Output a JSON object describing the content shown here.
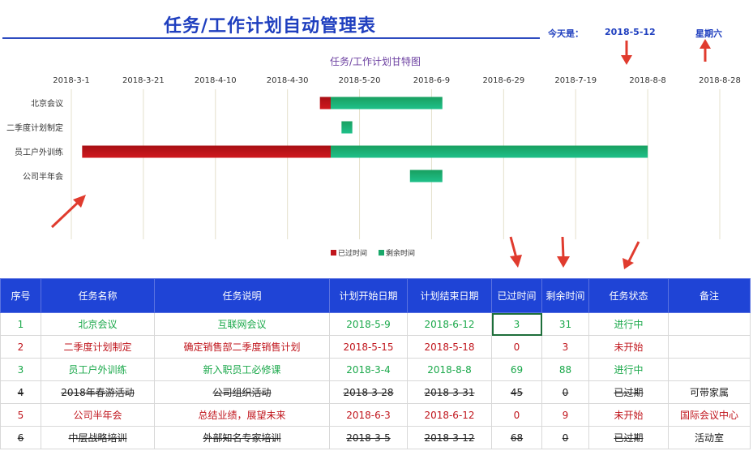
{
  "title": "任务/工作计划自动管理表",
  "today_label": "今天是：",
  "today_date": "2018-5-12",
  "weekday": "星期六",
  "colors": {
    "header_bg": "#1f44d6",
    "passed": "#c0151c",
    "remaining": "#19a86a",
    "title": "#1f3fbf"
  },
  "chart_data": {
    "type": "bar",
    "orientation": "horizontal-stacked-gantt",
    "title": "任务/工作计划甘特图",
    "x_ticks": [
      "2018-3-1",
      "2018-3-21",
      "2018-4-10",
      "2018-4-30",
      "2018-5-20",
      "2018-6-9",
      "2018-6-29",
      "2018-7-19",
      "2018-8-8",
      "2018-8-28"
    ],
    "xlim": [
      "2018-3-1",
      "2018-8-28"
    ],
    "grid": true,
    "legend_position": "bottom",
    "categories": [
      "北京会议",
      "二季度计划制定",
      "员工户外训练",
      "公司半年会"
    ],
    "series": [
      {
        "name": "已过时间",
        "color": "#c0151c",
        "segments": [
          {
            "start": "2018-5-9",
            "days": 3
          },
          {
            "start": "2018-5-15",
            "days": 0
          },
          {
            "start": "2018-3-4",
            "days": 69
          },
          {
            "start": "2018-6-3",
            "days": 0
          }
        ]
      },
      {
        "name": "剩余时间",
        "color": "#19a86a",
        "segments": [
          {
            "start": "2018-5-12",
            "days": 31
          },
          {
            "start": "2018-5-15",
            "days": 3
          },
          {
            "start": "2018-5-12",
            "days": 88
          },
          {
            "start": "2018-6-3",
            "days": 9
          }
        ]
      }
    ]
  },
  "table": {
    "headers": [
      "序号",
      "任务名称",
      "任务说明",
      "计划开始日期",
      "计划结束日期",
      "已过时间",
      "剩余时间",
      "任务状态",
      "备注"
    ],
    "rows": [
      {
        "cls": "green",
        "cells": [
          "1",
          "北京会议",
          "互联网会议",
          "2018-5-9",
          "2018-6-12",
          "3",
          "31",
          "进行中",
          ""
        ]
      },
      {
        "cls": "red",
        "cells": [
          "2",
          "二季度计划制定",
          "确定销售部二季度销售计划",
          "2018-5-15",
          "2018-5-18",
          "0",
          "3",
          "未开始",
          ""
        ]
      },
      {
        "cls": "green",
        "cells": [
          "3",
          "员工户外训练",
          "新入职员工必修课",
          "2018-3-4",
          "2018-8-8",
          "69",
          "88",
          "进行中",
          ""
        ]
      },
      {
        "cls": "black",
        "cells": [
          "4",
          "2018年春游活动",
          "公司组织活动",
          "2018-3-28",
          "2018-3-31",
          "45",
          "0",
          "已过期",
          "可带家属"
        ]
      },
      {
        "cls": "red",
        "cells": [
          "5",
          "公司半年会",
          "总结业绩，展望未来",
          "2018-6-3",
          "2018-6-12",
          "0",
          "9",
          "未开始",
          "国际会议中心"
        ]
      },
      {
        "cls": "black",
        "cells": [
          "6",
          "中层战略培训",
          "外部知名专家培训",
          "2018-3-5",
          "2018-3-12",
          "68",
          "0",
          "已过期",
          "活动室"
        ]
      }
    ]
  }
}
